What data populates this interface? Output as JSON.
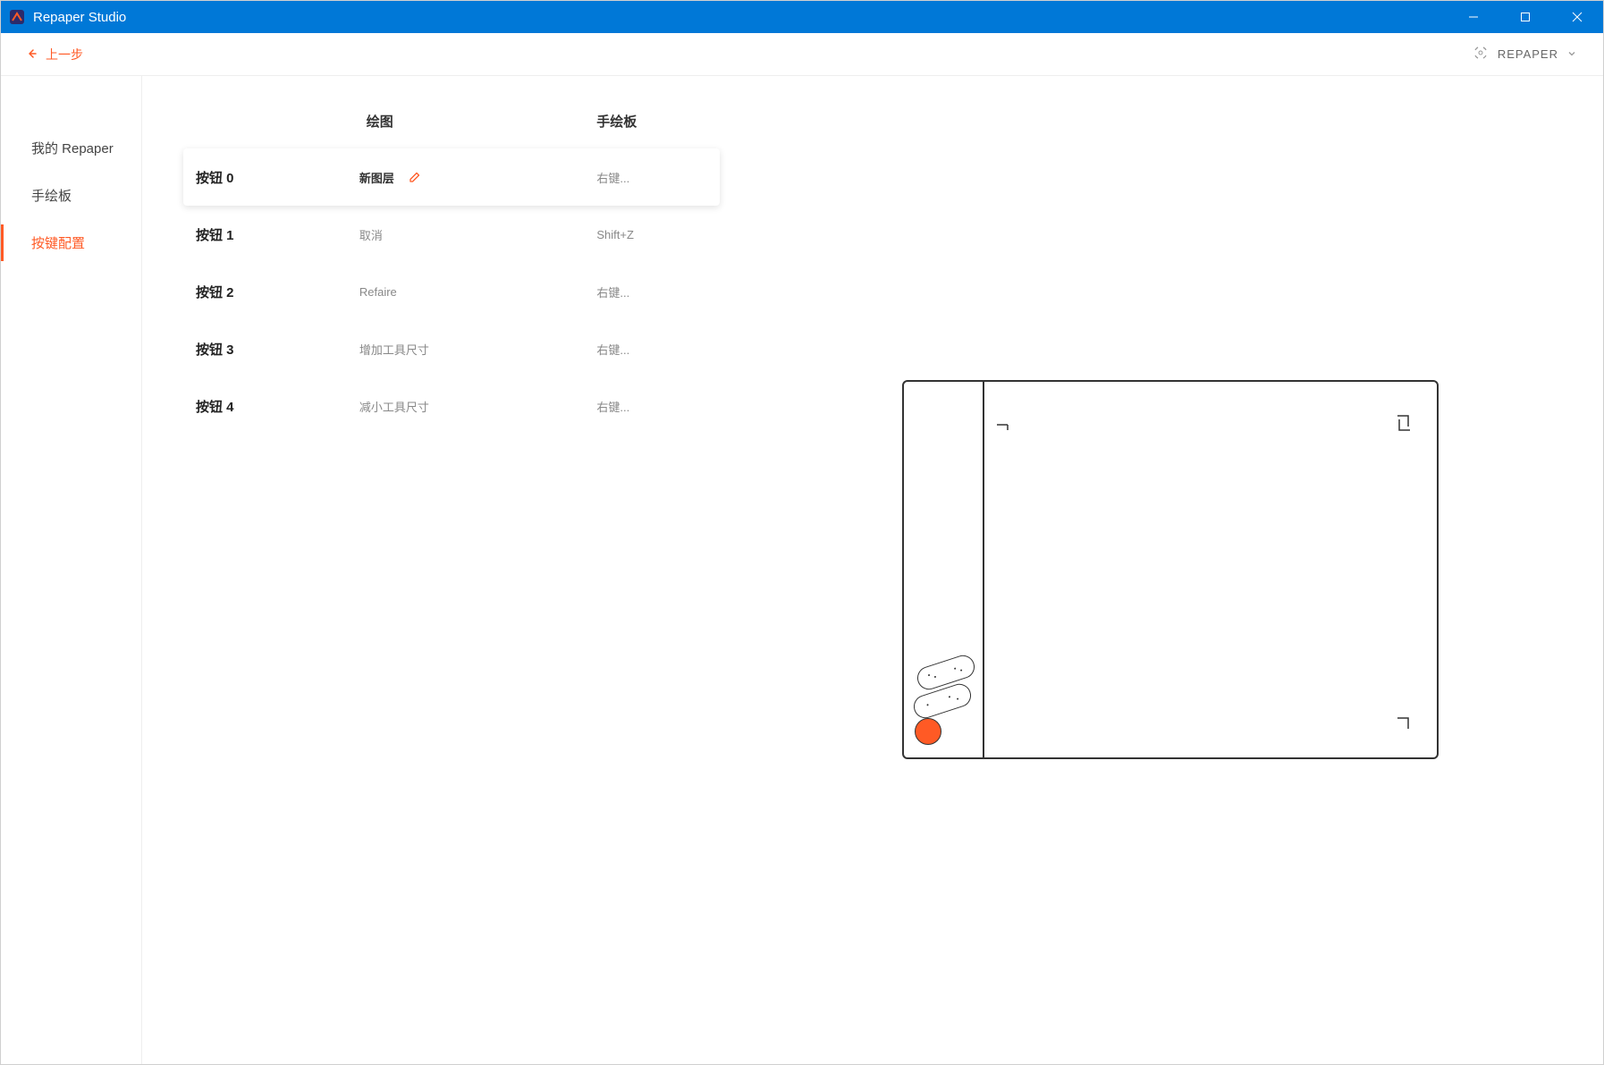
{
  "title": "Repaper Studio",
  "toolbar": {
    "back_label": "上一步",
    "device_label": "REPAPER"
  },
  "sidebar": {
    "items": [
      {
        "label": "我的 Repaper"
      },
      {
        "label": "手绘板"
      },
      {
        "label": "按键配置"
      }
    ]
  },
  "table": {
    "headers": {
      "drawing": "绘图",
      "tablet": "手绘板"
    },
    "rows": [
      {
        "button": "按钮 0",
        "drawing": "新图层",
        "tablet": "右键...",
        "selected": true
      },
      {
        "button": "按钮 1",
        "drawing": "取消",
        "tablet": "Shift+Z",
        "selected": false
      },
      {
        "button": "按钮 2",
        "drawing": "Refaire",
        "tablet": "右键...",
        "selected": false
      },
      {
        "button": "按钮 3",
        "drawing": "增加工具尺寸",
        "tablet": "右键...",
        "selected": false
      },
      {
        "button": "按钮 4",
        "drawing": "减小工具尺寸",
        "tablet": "右键...",
        "selected": false
      }
    ]
  }
}
